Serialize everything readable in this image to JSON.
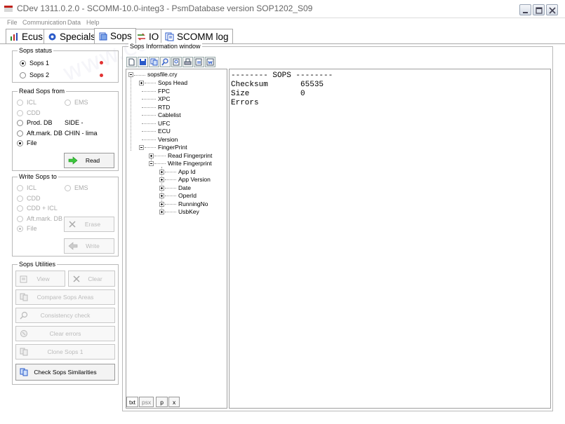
{
  "window": {
    "title": "CDev 1311.0.2.0 - SCOMM-10.0-integ3 - PsmDatabase version SOP1202_S09"
  },
  "menu": [
    "File",
    "Communication",
    "Data",
    "Help"
  ],
  "tabs": [
    {
      "label": "Ecus",
      "icon": "ecus-icon"
    },
    {
      "label": "Specials",
      "icon": "specials-icon"
    },
    {
      "label": "Sops",
      "icon": "sops-icon",
      "active": true
    },
    {
      "label": "IO",
      "icon": "io-icon"
    },
    {
      "label": "SCOMM log",
      "icon": "scomm-log-icon"
    }
  ],
  "sops_status": {
    "title": "Sops status",
    "items": [
      {
        "label": "Sops 1",
        "selected": true,
        "led_color": "#e23232"
      },
      {
        "label": "Sops 2",
        "selected": false,
        "led_color": "#e23232"
      }
    ]
  },
  "read_sops": {
    "title": "Read Sops from",
    "icl": "ICL",
    "ems": "EMS",
    "cdd": "CDD",
    "prod_db": "Prod. DB",
    "prod_db_value": "SIDE -",
    "aft_mark_db": "Aft.mark. DB",
    "aft_mark_db_value": "CHIN - lima",
    "file": "File",
    "read_button": "Read"
  },
  "write_sops": {
    "title": "Write Sops to",
    "icl": "ICL",
    "ems": "EMS",
    "cdd": "CDD",
    "cdd_icl": "CDD + ICL",
    "aft_mark_db": "Aft.mark. DB",
    "file": "File",
    "erase_button": "Erase",
    "write_button": "Write"
  },
  "sops_utilities": {
    "title": "Sops Utilities",
    "view": "View",
    "clear": "Clear",
    "compare": "Compare Sops Areas",
    "consistency": "Consistency check",
    "clear_errors": "Clear errors",
    "clone": "Clone Sops 1",
    "check_similarities": "Check Sops Similarities"
  },
  "info_window": {
    "title": "Sops Information window",
    "tree": {
      "root": "sopsfile.cry",
      "sops_head": "Sops Head",
      "fpc": "FPC",
      "xpc": "XPC",
      "rtd": "RTD",
      "cablelist": "Cablelist",
      "ufc": "UFC",
      "ecu": "ECU",
      "version": "Version",
      "fingerprint": "FingerPrint",
      "read_fingerprint": "Read Fingerprint",
      "write_fingerprint": "Write Fingerprint",
      "app_id": "App Id",
      "app_version": "App Version",
      "date": "Date",
      "oper_id": "OperId",
      "running_no": "RunningNo",
      "usb_key": "UsbKey"
    },
    "bottom_tabs": [
      "txt",
      "psx",
      "p",
      "x"
    ],
    "text_lines": [
      "-------- SOPS --------",
      "Checksum       65535",
      "Size           0",
      "Errors"
    ]
  }
}
